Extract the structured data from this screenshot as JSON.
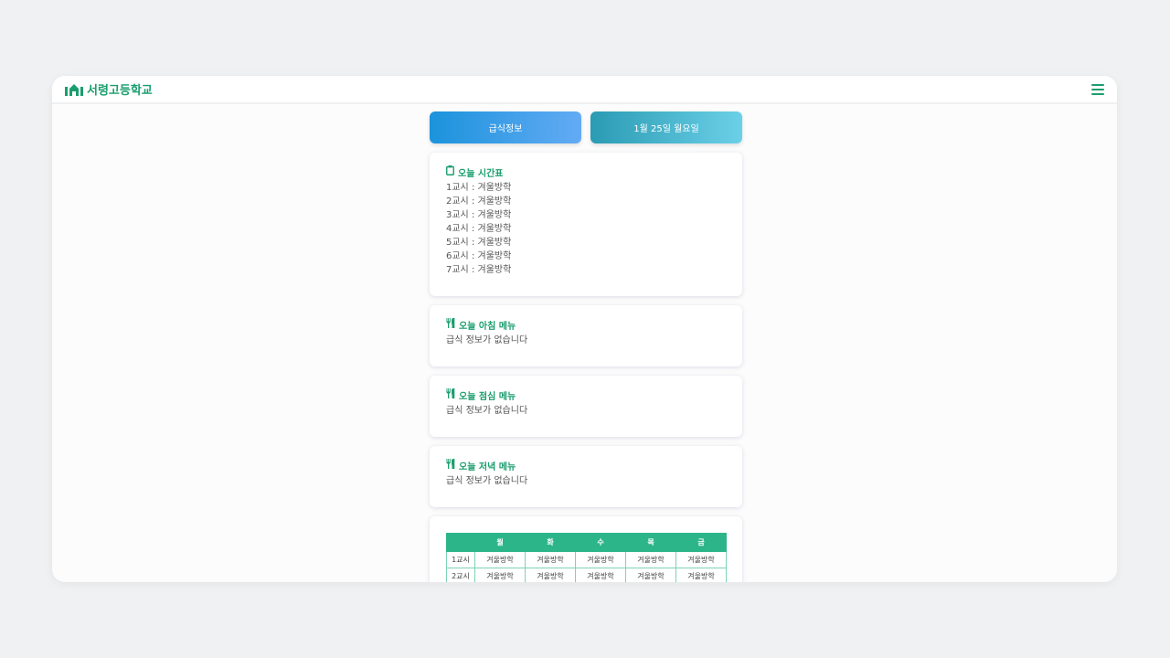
{
  "brand": {
    "name": "서령고등학교"
  },
  "buttons": {
    "meal_info": "급식정보",
    "date": "1월 25일 월요일"
  },
  "schedule": {
    "title": "오늘 시간표",
    "periods": [
      "1교시 : 겨울방학",
      "2교시 : 겨울방학",
      "3교시 : 겨울방학",
      "4교시 : 겨울방학",
      "5교시 : 겨울방학",
      "6교시 : 겨울방학",
      "7교시 : 겨울방학"
    ]
  },
  "meals": [
    {
      "title": "오늘 아침 메뉴",
      "text": "급식 정보가 없습니다"
    },
    {
      "title": "오늘 점심 메뉴",
      "text": "급식 정보가 없습니다"
    },
    {
      "title": "오늘 저녁 메뉴",
      "text": "급식 정보가 없습니다"
    }
  ],
  "timetable": {
    "headers": [
      "",
      "월",
      "화",
      "수",
      "목",
      "금"
    ],
    "rows": [
      [
        "1교시",
        "겨울방학",
        "겨울방학",
        "겨울방학",
        "겨울방학",
        "겨울방학"
      ],
      [
        "2교시",
        "겨울방학",
        "겨울방학",
        "겨울방학",
        "겨울방학",
        "겨울방학"
      ]
    ]
  },
  "colors": {
    "accent": "#1a9e6e",
    "table_header": "#2db58a"
  },
  "icons": {
    "logo": "school-logo-icon",
    "menu": "hamburger-menu-icon",
    "schedule": "clipboard-icon",
    "meal": "utensils-icon"
  }
}
